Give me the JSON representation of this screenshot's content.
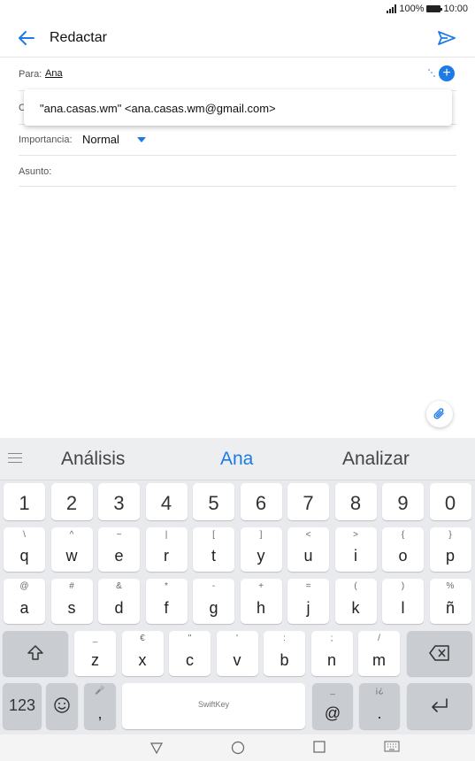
{
  "status_bar": {
    "battery": "100%",
    "time": "10:00"
  },
  "app_bar": {
    "title": "Redactar"
  },
  "to_field": {
    "label": "Para:",
    "recipient": "Ana"
  },
  "suggestion": {
    "text": "\"ana.casas.wm\" <ana.casas.wm@gmail.com>"
  },
  "cc_field": {
    "label": "C"
  },
  "importance": {
    "label": "Importancia:",
    "value": "Normal"
  },
  "subject": {
    "label": "Asunto:"
  },
  "keyboard": {
    "predictions": [
      "Análisis",
      "Ana",
      "Analizar"
    ],
    "numbers": [
      "1",
      "2",
      "3",
      "4",
      "5",
      "6",
      "7",
      "8",
      "9",
      "0"
    ],
    "row1": [
      {
        "alt": "\\",
        "key": "q"
      },
      {
        "alt": "^",
        "key": "w"
      },
      {
        "alt": "~",
        "key": "e"
      },
      {
        "alt": "|",
        "key": "r"
      },
      {
        "alt": "[",
        "key": "t"
      },
      {
        "alt": "]",
        "key": "y"
      },
      {
        "alt": "<",
        "key": "u"
      },
      {
        "alt": ">",
        "key": "i"
      },
      {
        "alt": "{",
        "key": "o"
      },
      {
        "alt": "}",
        "key": "p"
      }
    ],
    "row2": [
      {
        "alt": "@",
        "key": "a"
      },
      {
        "alt": "#",
        "key": "s"
      },
      {
        "alt": "&",
        "key": "d"
      },
      {
        "alt": "*",
        "key": "f"
      },
      {
        "alt": "-",
        "key": "g"
      },
      {
        "alt": "+",
        "key": "h"
      },
      {
        "alt": "=",
        "key": "j"
      },
      {
        "alt": "(",
        "key": "k"
      },
      {
        "alt": ")",
        "key": "l"
      },
      {
        "alt": "%",
        "key": "ñ"
      }
    ],
    "row3": [
      {
        "alt": "_",
        "key": "z"
      },
      {
        "alt": "€",
        "key": "x"
      },
      {
        "alt": "\"",
        "key": "c"
      },
      {
        "alt": "'",
        "key": "v"
      },
      {
        "alt": ":",
        "key": "b"
      },
      {
        "alt": ";",
        "key": "n"
      },
      {
        "alt": "/",
        "key": "m"
      }
    ],
    "bottom": {
      "symbols": "123",
      "comma": ",",
      "comma_alt": "🎤",
      "space_brand": "SwiftKey",
      "at": "@",
      "at_alt": "_",
      "period": ".",
      "period_alt": "¡¿"
    }
  },
  "icons": {
    "back": "arrow-left-icon",
    "send": "send-icon",
    "add": "plus-icon",
    "attach": "paperclip-icon",
    "shift": "shift-icon",
    "backspace": "backspace-icon",
    "emoji": "emoji-icon",
    "enter": "enter-icon",
    "nav_back": "triangle-back-icon",
    "nav_home": "circle-home-icon",
    "nav_recent": "square-recent-icon",
    "nav_keyboard": "keyboard-icon"
  },
  "colors": {
    "accent": "#1e7be6"
  }
}
